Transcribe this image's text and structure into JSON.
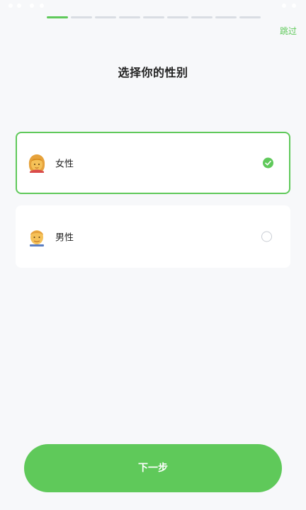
{
  "progress": {
    "total_steps": 9,
    "current_step": 1
  },
  "header": {
    "skip_label": "跳过",
    "title": "选择你的性别"
  },
  "options": [
    {
      "label": "女性",
      "icon": "woman-emoji-icon",
      "selected": true
    },
    {
      "label": "男性",
      "icon": "man-emoji-icon",
      "selected": false
    }
  ],
  "footer": {
    "next_label": "下一步"
  },
  "colors": {
    "accent": "#5fc95a",
    "background": "#f7f8fa"
  }
}
